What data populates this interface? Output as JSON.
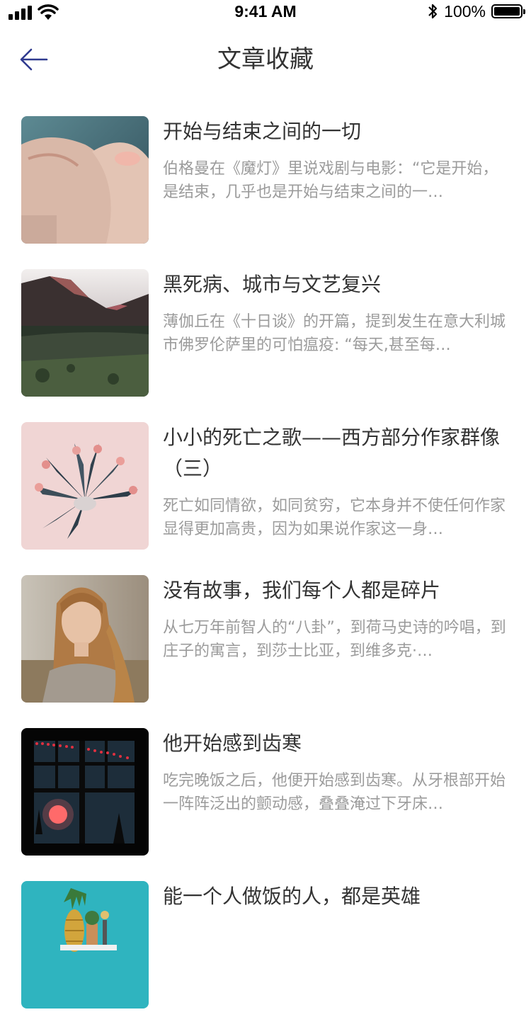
{
  "status_bar": {
    "time": "9:41 AM",
    "battery_percent": "100%",
    "icons": [
      "signal-icon",
      "wifi-icon",
      "bluetooth-icon",
      "battery-icon"
    ]
  },
  "nav": {
    "title": "文章收藏",
    "back_icon": "arrow-left-icon"
  },
  "colors": {
    "accent": "#2f3a8f",
    "title_text": "#333333",
    "excerpt_text": "#9b9b9b"
  },
  "articles": [
    {
      "title": "开始与结束之间的一切",
      "excerpt": "伯格曼在《魔灯》里说戏剧与电影：“它是开始，是结束，几乎也是开始与结束之间的一…",
      "image": "hands-photo"
    },
    {
      "title": "黑死病、城市与文艺复兴",
      "excerpt": "薄伽丘在《十日谈》的开篇，提到发生在意大利城市佛罗伦萨里的可怕瘟疫: “每天,甚至每…",
      "image": "mountain-landscape-photo"
    },
    {
      "title": "小小的死亡之歌——西方部分作家群像（三）",
      "excerpt": "死亡如同情欲，如同贫穷，它本身并不使任何作家显得更加高贵，因为如果说作家这一身…",
      "image": "flower-arrangement-photo"
    },
    {
      "title": "没有故事，我们每个人都是碎片",
      "excerpt": "从七万年前智人的“八卦”，到荷马史诗的吟唱，到庄子的寓言，到莎士比亚，到维多克·…",
      "image": "portrait-woman-photo"
    },
    {
      "title": "他开始感到齿寒",
      "excerpt": "吃完晚饭之后，他便开始感到齿寒。从牙根部开始一阵阵泛出的颤动感，叠叠淹过下牙床…",
      "image": "night-window-photo"
    },
    {
      "title": "能一个人做饭的人，都是英雄",
      "excerpt": "",
      "image": "pineapple-still-life-photo"
    }
  ]
}
